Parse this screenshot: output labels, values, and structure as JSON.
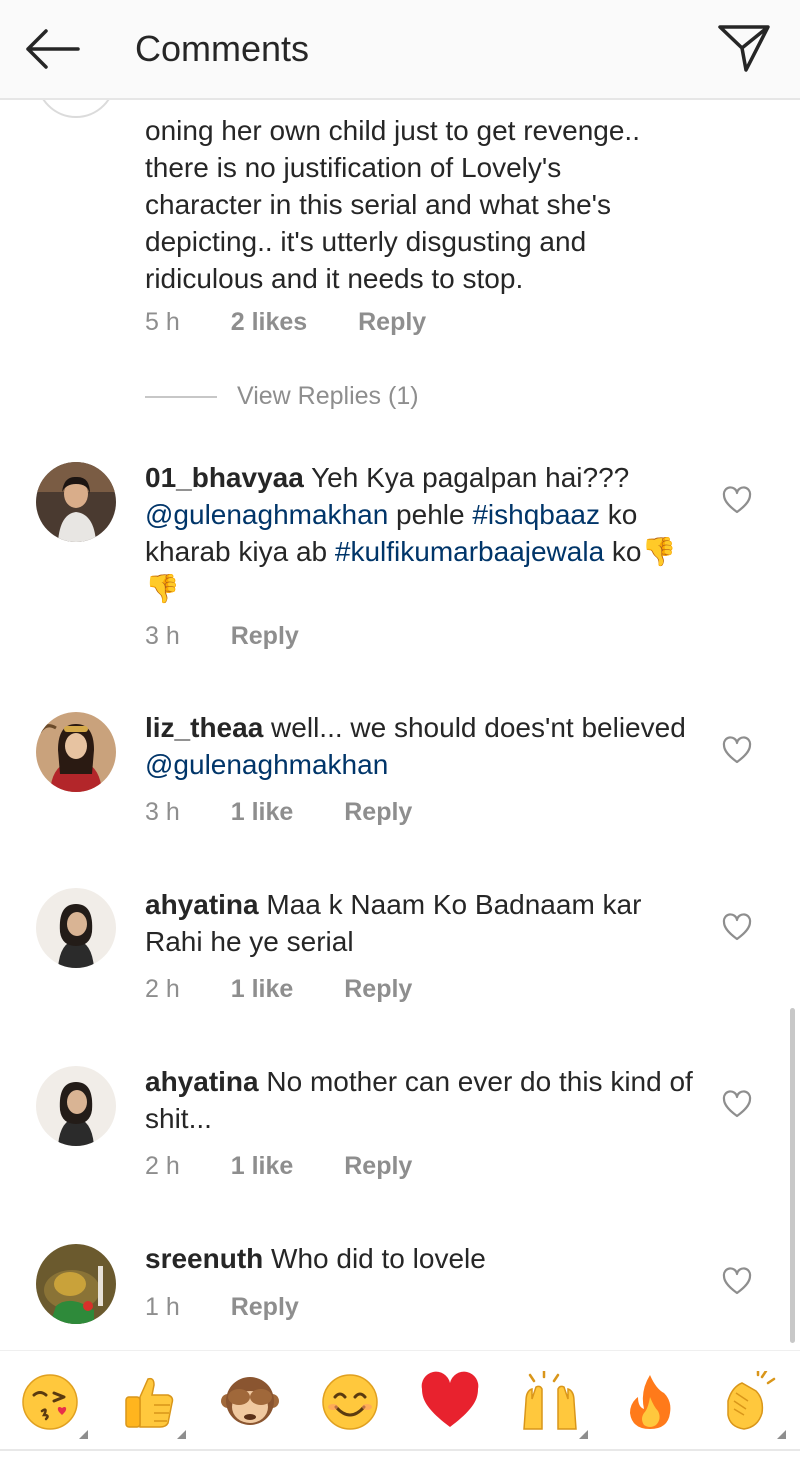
{
  "header": {
    "title": "Comments"
  },
  "comments": [
    {
      "text_lines": [
        "oning her own child just to get revenge..",
        "there is no justification of Lovely's",
        "character in this serial and what she's",
        "depicting.. it's utterly disgusting and",
        "ridiculous and it needs to stop."
      ],
      "time": "5 h",
      "likes": "2 likes",
      "reply": "Reply",
      "view_replies": "View Replies (1)"
    },
    {
      "username": "01_bhavyaa",
      "text_a": " Yeh Kya pagalpan hai???",
      "mention": "@gulenaghmakhan",
      "text_b": " pehle ",
      "hashtag1": "#ishqbaaz",
      "text_c": " ko kharab kiya ab ",
      "hashtag2": "#kulfikumarbaajewala",
      "text_d": " ko",
      "emoji": "👎👎",
      "time": "3 h",
      "reply": "Reply"
    },
    {
      "username": "liz_theaa",
      "text_a": " well... we should does'nt believed ",
      "mention": "@gulenaghmakhan",
      "time": "3 h",
      "likes": "1 like",
      "reply": "Reply"
    },
    {
      "username": "ahyatina",
      "text_a": " Maa k Naam Ko Badnaam kar Rahi he ye serial",
      "time": "2 h",
      "likes": "1 like",
      "reply": "Reply"
    },
    {
      "username": "ahyatina",
      "text_a": " No mother can ever do this kind of shit...",
      "time": "2 h",
      "likes": "1 like",
      "reply": "Reply"
    },
    {
      "username": "sreenuth",
      "text_a": " Who did to lovele",
      "time": "1 h",
      "reply": "Reply"
    }
  ],
  "emoji_bar": {
    "items": [
      "face-blowing-kiss",
      "thumbs-up",
      "see-no-evil-monkey",
      "smiling-face",
      "red-heart",
      "raising-hands",
      "fire",
      "clapping-hands"
    ]
  },
  "colors": {
    "text": "#262626",
    "secondary": "#8e8e8e",
    "link": "#003569",
    "header_bg": "#fafafa"
  }
}
